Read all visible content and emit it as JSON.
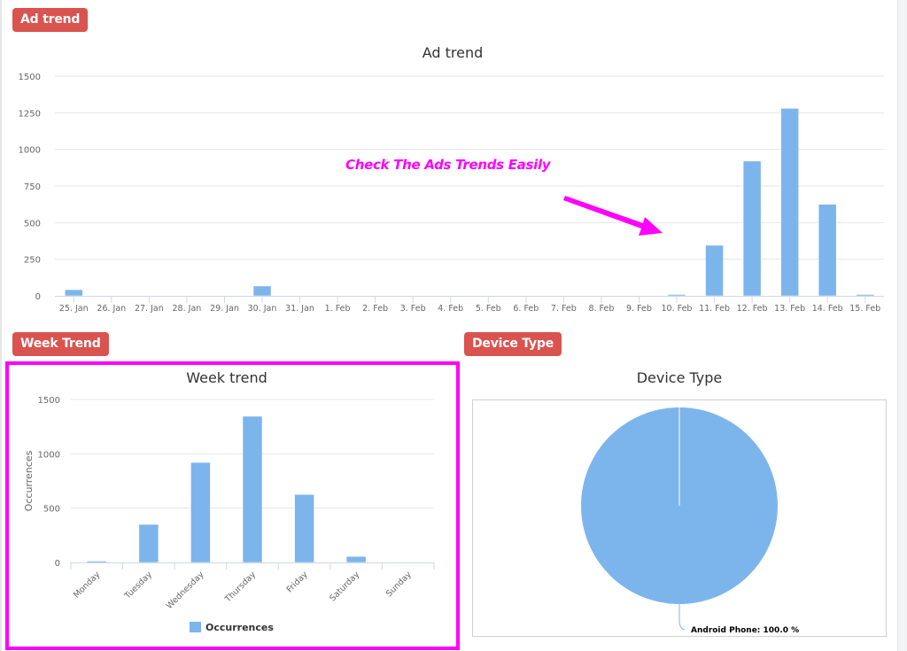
{
  "colors": {
    "badge": "#d9534f",
    "bar": "#7cb5ec",
    "highlight": "#ff00ff",
    "grid": "#e6e6e6",
    "axis_text": "#666666",
    "title_text": "#333333"
  },
  "sections": {
    "ad_trend_badge": "Ad trend",
    "week_trend_badge": "Week Trend",
    "device_type_badge": "Device Type"
  },
  "annotation": {
    "text": "Check The Ads Trends Easily",
    "arrow_icon": "arrow-down-right"
  },
  "chart_data": [
    {
      "id": "ad_trend",
      "type": "bar",
      "title": "Ad trend",
      "xlabel": "",
      "ylabel": "",
      "ylim": [
        0,
        1500
      ],
      "yticks": [
        0,
        250,
        500,
        750,
        1000,
        1250,
        1500
      ],
      "grid": true,
      "legend": "none",
      "categories": [
        "25. Jan",
        "26. Jan",
        "27. Jan",
        "28. Jan",
        "29. Jan",
        "30. Jan",
        "31. Jan",
        "1. Feb",
        "2. Feb",
        "3. Feb",
        "4. Feb",
        "5. Feb",
        "6. Feb",
        "7. Feb",
        "8. Feb",
        "9. Feb",
        "10. Feb",
        "11. Feb",
        "12. Feb",
        "13. Feb",
        "14. Feb",
        "15. Feb"
      ],
      "values": [
        42,
        0,
        0,
        0,
        0,
        67,
        0,
        0,
        0,
        0,
        0,
        0,
        0,
        0,
        0,
        0,
        6,
        345,
        920,
        1280,
        625,
        5
      ]
    },
    {
      "id": "week_trend",
      "type": "bar",
      "title": "Week trend",
      "xlabel": "",
      "ylabel": "Occurrences",
      "ylim": [
        0,
        1500
      ],
      "yticks": [
        0,
        500,
        1000,
        1500
      ],
      "grid": true,
      "legend": "bottom-center",
      "categories": [
        "Monday",
        "Tuesday",
        "Wednesday",
        "Thursday",
        "Friday",
        "Saturday",
        "Sunday"
      ],
      "series": [
        {
          "name": "Occurrences",
          "values": [
            10,
            350,
            920,
            1345,
            625,
            55,
            0
          ]
        }
      ]
    },
    {
      "id": "device_type",
      "type": "pie",
      "title": "Device Type",
      "legend": "none",
      "slices": [
        {
          "label": "Android Phone",
          "value": 100.0,
          "data_label": "Android Phone: 100.0 %"
        }
      ]
    }
  ]
}
